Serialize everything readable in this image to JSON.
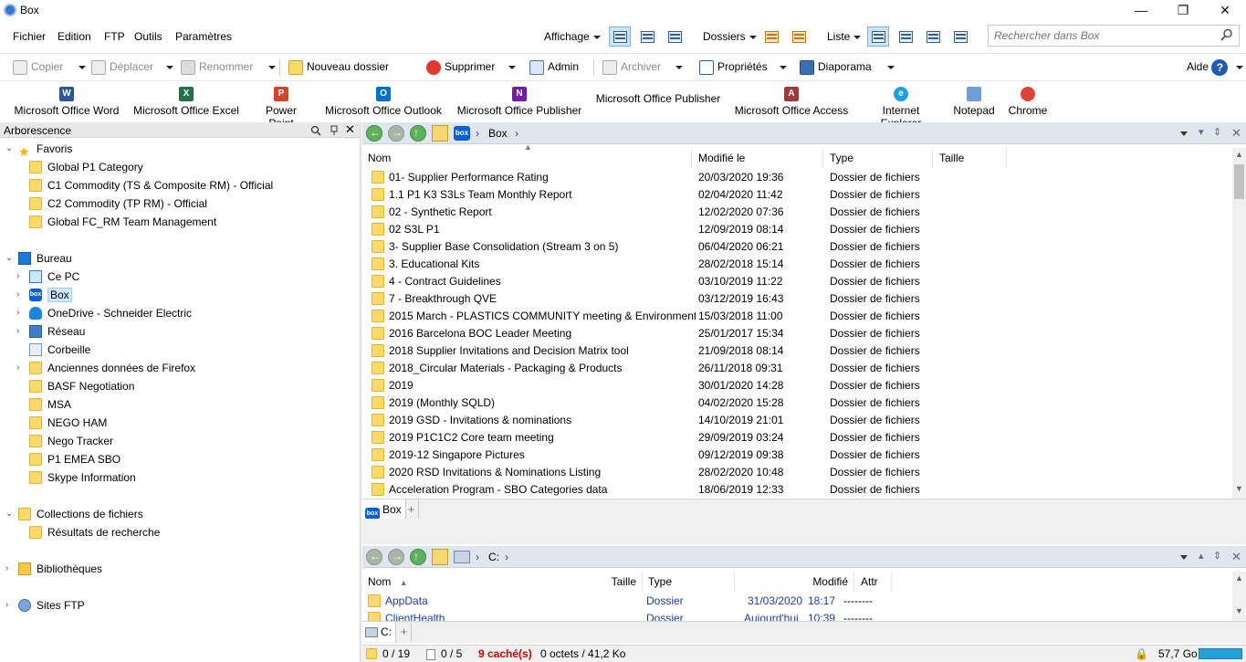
{
  "window": {
    "title": "Box",
    "minimize": "—",
    "maximize": "❐",
    "close": "✕"
  },
  "menubar": {
    "menus": [
      "Fichier",
      "Edition",
      "FTP",
      "Outils",
      "Paramètres"
    ],
    "affichage": "Affichage",
    "dossiers": "Dossiers",
    "liste": "Liste",
    "search_placeholder": "Rechercher dans Box"
  },
  "toolbar": {
    "copier": "Copier",
    "deplacer": "Déplacer",
    "renommer": "Renommer",
    "nouveau_dossier": "Nouveau dossier",
    "supprimer": "Supprimer",
    "admin": "Admin",
    "archiver": "Archiver",
    "proprietes": "Propriétés",
    "diaporama": "Diaporama",
    "aide": "Aide"
  },
  "quicklaunch": [
    {
      "label": "Microsoft Office Word",
      "color": "#2b579a",
      "letter": "W"
    },
    {
      "label": "Microsoft Office Excel",
      "color": "#217346",
      "letter": "X"
    },
    {
      "label": "Power Point",
      "color": "#d24726",
      "letter": "P"
    },
    {
      "label": "Microsoft Office Outlook",
      "color": "#0072c6",
      "letter": "O"
    },
    {
      "label": "Microsoft Office Publisher",
      "color": "#7719aa",
      "letter": "N"
    },
    {
      "label": "Microsoft Office Publisher",
      "color": "",
      "letter": ""
    },
    {
      "label": "Microsoft Office Access",
      "color": "#a4373a",
      "letter": "A"
    },
    {
      "label": "Internet Explorer",
      "color": "#1ea1e1",
      "letter": "e"
    },
    {
      "label": "Notepad",
      "color": "#6d9fd6",
      "letter": ""
    },
    {
      "label": "Chrome",
      "color": "#db4437",
      "letter": ""
    }
  ],
  "left": {
    "header": "Arborescence",
    "favoris": "Favoris",
    "favorites": [
      "Global P1 Category",
      "C1 Commodity (TS & Composite RM) - Official",
      "C2 Commodity (TP RM) - Official",
      "Global FC_RM Team Management"
    ],
    "bureau": "Bureau",
    "bureau_items": [
      "Ce PC",
      "Box",
      "OneDrive - Schneider Electric",
      "Réseau",
      "Corbeille",
      "Anciennes données de Firefox",
      "BASF Negotiation",
      "MSA",
      "NEGO HAM",
      "Nego Tracker",
      "P1 EMEA SBO",
      "Skype Information"
    ],
    "collections": "Collections de fichiers",
    "resultats": "Résultats de recherche",
    "bibliotheques": "Bibliothèques",
    "sites_ftp": "Sites FTP"
  },
  "top_pane": {
    "breadcrumb": "Box",
    "box_logo": "box",
    "columns": {
      "name": "Nom",
      "modified": "Modifié le",
      "type": "Type",
      "size": "Taille"
    },
    "rows": [
      {
        "name": "01- Supplier Performance Rating",
        "modified": "20/03/2020 19:36",
        "type": "Dossier de fichiers"
      },
      {
        "name": "1.1 P1 K3 S3Ls Team Monthly Report",
        "modified": "02/04/2020 11:42",
        "type": "Dossier de fichiers"
      },
      {
        "name": "02 - Synthetic Report",
        "modified": "12/02/2020 07:36",
        "type": "Dossier de fichiers"
      },
      {
        "name": "02 S3L P1",
        "modified": "12/09/2019 08:14",
        "type": "Dossier de fichiers"
      },
      {
        "name": "3- Supplier Base Consolidation (Stream 3 on 5)",
        "modified": "06/04/2020 06:21",
        "type": "Dossier de fichiers"
      },
      {
        "name": "3. Educational Kits",
        "modified": "28/02/2018 15:14",
        "type": "Dossier de fichiers"
      },
      {
        "name": "4 - Contract Guidelines",
        "modified": "03/10/2019 11:22",
        "type": "Dossier de fichiers"
      },
      {
        "name": "7 - Breakthrough QVE",
        "modified": "03/12/2019 16:43",
        "type": "Dossier de fichiers"
      },
      {
        "name": "2015 March - PLASTICS COMMUNITY meeting & Environment",
        "modified": "15/03/2018 11:00",
        "type": "Dossier de fichiers"
      },
      {
        "name": "2016 Barcelona BOC Leader Meeting",
        "modified": "25/01/2017 15:34",
        "type": "Dossier de fichiers"
      },
      {
        "name": "2018 Supplier Invitations and Decision Matrix tool",
        "modified": "21/09/2018 08:14",
        "type": "Dossier de fichiers"
      },
      {
        "name": "2018_Circular Materials - Packaging & Products",
        "modified": "26/11/2018 09:31",
        "type": "Dossier de fichiers"
      },
      {
        "name": "2019",
        "modified": "30/01/2020 14:28",
        "type": "Dossier de fichiers"
      },
      {
        "name": "2019 (Monthly SQLD)",
        "modified": "04/02/2020 15:28",
        "type": "Dossier de fichiers"
      },
      {
        "name": "2019 GSD - Invitations & nominations",
        "modified": "14/10/2019 21:01",
        "type": "Dossier de fichiers"
      },
      {
        "name": "2019 P1C1C2 Core team meeting",
        "modified": "29/09/2019 03:24",
        "type": "Dossier de fichiers"
      },
      {
        "name": "2019-12 Singapore Pictures",
        "modified": "09/12/2019 09:38",
        "type": "Dossier de fichiers"
      },
      {
        "name": "2020 RSD Invitations & Nominations Listing",
        "modified": "28/02/2020 10:48",
        "type": "Dossier de fichiers"
      },
      {
        "name": "Acceleration Program - SBO Categories data",
        "modified": "18/06/2019 12:33",
        "type": "Dossier de fichiers"
      }
    ],
    "tab": "Box"
  },
  "bottom_pane": {
    "breadcrumb": "C:",
    "columns": {
      "name": "Nom",
      "size": "Taille",
      "type": "Type",
      "modified": "Modifié",
      "attr": "Attr"
    },
    "rows": [
      {
        "name": "AppData",
        "type": "Dossier",
        "date": "31/03/2020",
        "time": "18:17",
        "attr": "--------"
      },
      {
        "name": "ClientHealth",
        "type": "Dossier",
        "date": "Aujourd'hui",
        "time": "10:39",
        "attr": "--------"
      }
    ],
    "tab": "C:"
  },
  "status": {
    "folders": "0 / 19",
    "files": "0 / 5",
    "hidden": "9 caché(s)",
    "bytes": "0 octets / 41,2 Ko",
    "disk": "57,7 Go",
    "hidden_color": "#d00000"
  }
}
